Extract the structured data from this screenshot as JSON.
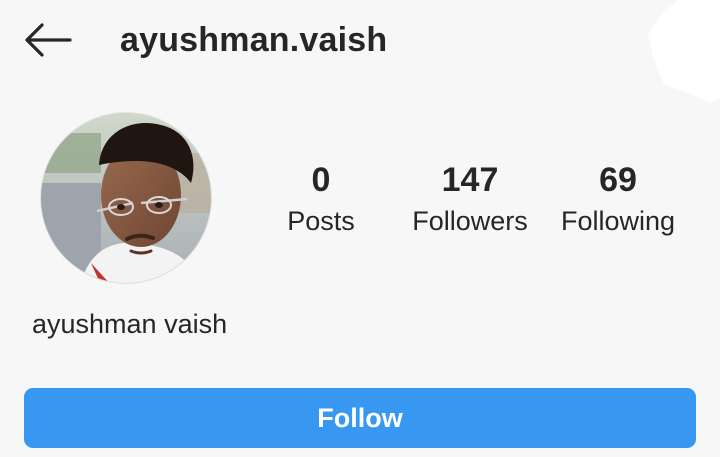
{
  "header": {
    "username": "ayushman.vaish",
    "back_icon": "arrow-left-icon"
  },
  "profile": {
    "display_name": "ayushman vaish",
    "avatar_icon": "profile-photo"
  },
  "stats": [
    {
      "value": "0",
      "label": "Posts"
    },
    {
      "value": "147",
      "label": "Followers"
    },
    {
      "value": "69",
      "label": "Following"
    }
  ],
  "actions": {
    "follow_label": "Follow"
  },
  "colors": {
    "accent": "#3897f0",
    "background": "#f7f7f7",
    "text": "#262626"
  }
}
